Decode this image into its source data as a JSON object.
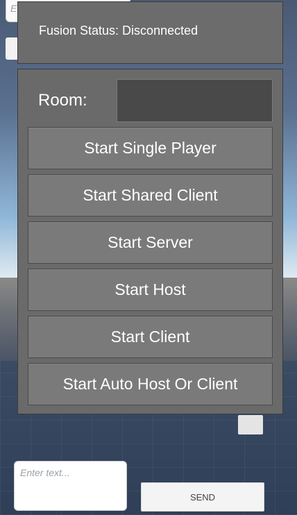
{
  "background": {
    "top_input_placeholder": "E"
  },
  "status": {
    "text": "Fusion Status: Disconnected"
  },
  "room": {
    "label": "Room:",
    "value": ""
  },
  "buttons": [
    {
      "label": "Start Single Player"
    },
    {
      "label": "Start Shared Client"
    },
    {
      "label": "Start Server"
    },
    {
      "label": "Start Host"
    },
    {
      "label": "Start Client"
    },
    {
      "label": "Start Auto Host Or Client"
    }
  ],
  "chat": {
    "placeholder": "Enter text...",
    "send_label": "SEND"
  },
  "colors": {
    "panel": "#6a6a6a",
    "button": "#7a7a7a",
    "room_input": "#494949",
    "text": "#ffffff"
  }
}
